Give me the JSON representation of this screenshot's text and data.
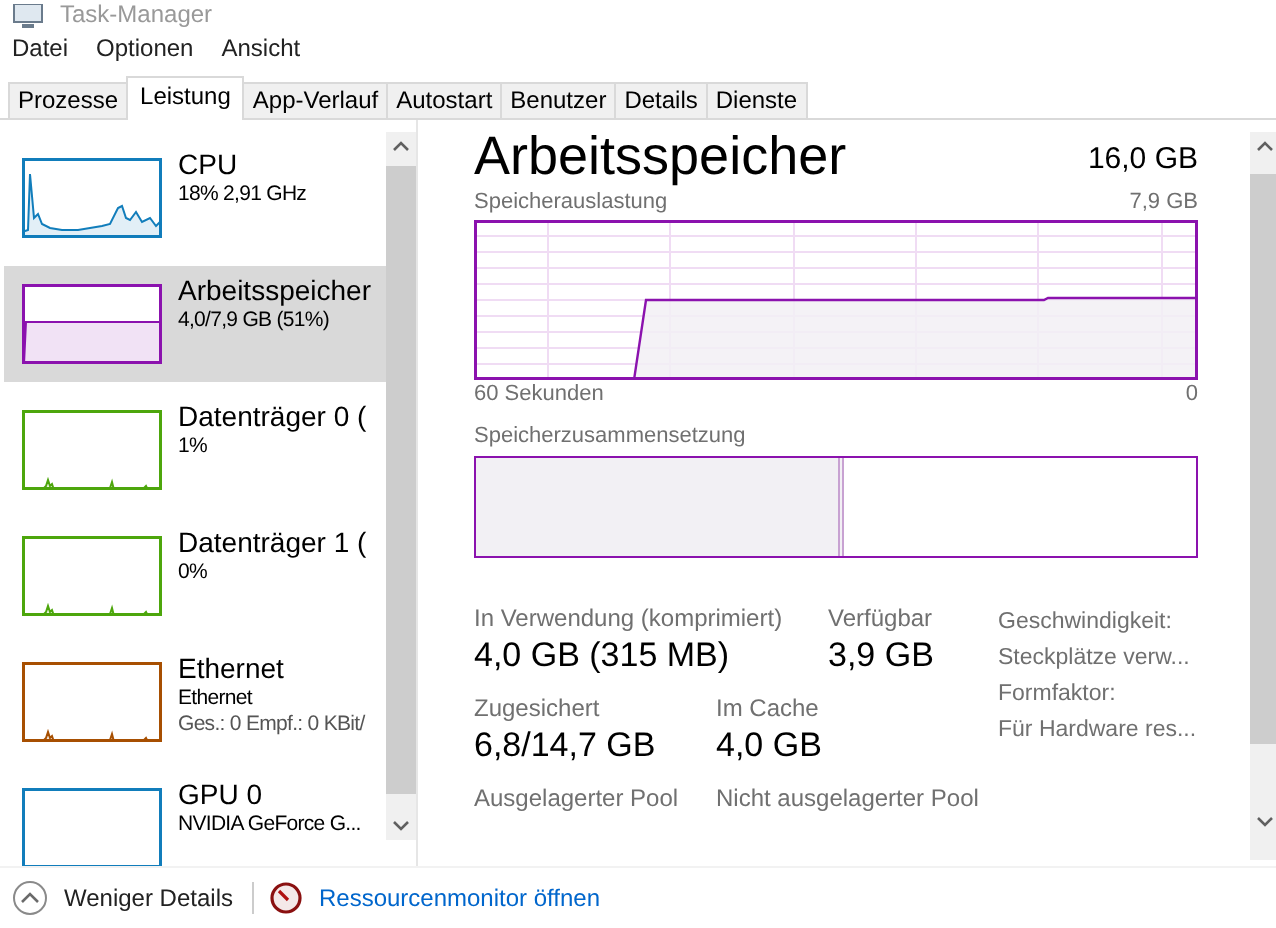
{
  "window": {
    "title": "Task-Manager"
  },
  "menu": [
    "Datei",
    "Optionen",
    "Ansicht"
  ],
  "tabs": [
    {
      "label": "Prozesse",
      "selected": false
    },
    {
      "label": "Leistung",
      "selected": true
    },
    {
      "label": "App-Verlauf",
      "selected": false
    },
    {
      "label": "Autostart",
      "selected": false
    },
    {
      "label": "Benutzer",
      "selected": false
    },
    {
      "label": "Details",
      "selected": false
    },
    {
      "label": "Dienste",
      "selected": false
    }
  ],
  "sidebar": {
    "items": [
      {
        "name": "CPU",
        "lines": [
          "18% 2,91 GHz"
        ],
        "color": "#117dbb",
        "selected": false
      },
      {
        "name": "Arbeitsspeicher",
        "lines": [
          "4,0/7,9 GB (51%)"
        ],
        "color": "#8b12ae",
        "selected": true
      },
      {
        "name": "Datenträger 0 (",
        "lines": [
          "1%"
        ],
        "color": "#4da60c",
        "selected": false
      },
      {
        "name": "Datenträger 1 (",
        "lines": [
          "0%"
        ],
        "color": "#4da60c",
        "selected": false
      },
      {
        "name": "Ethernet",
        "lines": [
          "Ethernet",
          "Ges.: 0 Empf.: 0 KBit/"
        ],
        "color": "#a74f01",
        "selected": false
      },
      {
        "name": "GPU 0",
        "lines": [
          "NVIDIA GeForce G..."
        ],
        "color": "#117dbb",
        "selected": false
      }
    ]
  },
  "detail": {
    "title": "Arbeitsspeicher",
    "total": "16,0 GB",
    "usage": {
      "label": "Speicherauslastung",
      "max": "7,9 GB",
      "time_start": "60 Sekunden",
      "time_end": "0"
    },
    "composition": {
      "label": "Speicherzusammensetzung",
      "level": 0.51
    },
    "stat_rows": [
      [
        {
          "label": "In Verwendung (komprimiert)",
          "value": "4,0 GB (315 MB)"
        },
        {
          "label": "Verfügbar",
          "value": "3,9 GB"
        }
      ],
      [
        {
          "label": "Zugesichert",
          "value": "6,8/14,7 GB"
        },
        {
          "label": "Im Cache",
          "value": "4,0 GB"
        }
      ],
      [
        {
          "label": "Ausgelagerter Pool"
        },
        {
          "label": "Nicht ausgelagerter Pool"
        }
      ]
    ],
    "properties": [
      "Geschwindigkeit:",
      "Steckplätze verw...",
      "Formfaktor:",
      "Für Hardware res..."
    ]
  },
  "footer": {
    "less_details": "Weniger Details",
    "resource_monitor": "Ressourcenmonitor öffnen"
  }
}
